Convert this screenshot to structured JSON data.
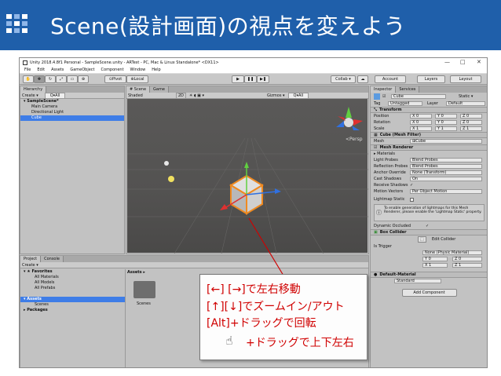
{
  "slide": {
    "title": "Scene(設計画面)の視点を変えよう"
  },
  "window": {
    "title": "Unity 2018.4.8f1 Personal - SampleScene.unity - ARTest - PC, Mac & Linux Standalone* <DX11>",
    "controls": [
      "—",
      "□",
      "✕"
    ]
  },
  "menu": [
    "File",
    "Edit",
    "Assets",
    "GameObject",
    "Component",
    "Window",
    "Help"
  ],
  "toolbar": {
    "pivot": "Pivot",
    "local": "Local",
    "collab": "Collab ▾",
    "account": "Account",
    "layers": "Layers",
    "layout": "Layout"
  },
  "hierarchy": {
    "tab": "Hierarchy",
    "create": "Create ▾",
    "search": "Q▾All",
    "items": [
      {
        "label": "▾ SampleScene*",
        "selected": false
      },
      {
        "label": "Main Camera",
        "selected": false
      },
      {
        "label": "Directional Light",
        "selected": false
      },
      {
        "label": "Cube",
        "selected": true
      }
    ]
  },
  "scene": {
    "tab_scene": "# Scene",
    "tab_game": "Game",
    "shaded": "Shaded",
    "mode2d": "2D",
    "gizmos": "Gizmos ▾",
    "search": "Q▾All",
    "persp": "<Persp"
  },
  "inspector": {
    "tab_inspector": "Inspector",
    "tab_services": "Services",
    "object_name": "Cube",
    "static": "Static ▾",
    "tag_label": "Tag",
    "tag_value": "Untagged",
    "layer_label": "Layer",
    "layer_value": "Default",
    "transform": {
      "title": "Transform",
      "rows": [
        {
          "label": "Position",
          "x": "0",
          "y": "0",
          "z": "0"
        },
        {
          "label": "Rotation",
          "x": "0",
          "y": "0",
          "z": "0"
        },
        {
          "label": "Scale",
          "x": "1",
          "y": "1",
          "z": "1"
        }
      ]
    },
    "mesh_filter": {
      "title": "Cube (Mesh Filter)",
      "mesh_label": "Mesh",
      "mesh_value": "⊞Cube"
    },
    "mesh_renderer": {
      "title": "Mesh Renderer",
      "materials": "▸ Materials",
      "rows": [
        {
          "label": "Light Probes",
          "value": "Blend Probes"
        },
        {
          "label": "Reflection Probes",
          "value": "Blend Probes"
        },
        {
          "label": "Anchor Override",
          "value": "None (Transform)"
        },
        {
          "label": "Cast Shadows",
          "value": "On"
        },
        {
          "label": "Receive Shadows",
          "value": "✓"
        },
        {
          "label": "Motion Vectors",
          "value": "Per Object Motion"
        },
        {
          "label": "Lightmap Static",
          "value": ""
        }
      ],
      "info": "To enable generation of lightmaps for this Mesh Renderer, please enable the 'Lightmap Static' property.",
      "dynamic_occluded": "Dynamic Occluded"
    },
    "box_collider": {
      "title": "Box Collider",
      "edit_collider": "Edit Collider",
      "is_trigger": "Is Trigger",
      "material_value": "None (Physic Material)",
      "center": {
        "x": "0",
        "y": "0",
        "z": "0"
      },
      "size": {
        "x": "1",
        "y": "1",
        "z": "1"
      }
    },
    "default_material": "Default-Material",
    "shader_value": "Standard",
    "add_component": "Add Component"
  },
  "project": {
    "tab_project": "Project",
    "tab_console": "Console",
    "create": "Create ▾",
    "tree": [
      {
        "label": "▾ ★ Favorites",
        "bold": true
      },
      {
        "label": "All Materials",
        "bold": false
      },
      {
        "label": "All Models",
        "bold": false
      },
      {
        "label": "All Prefabs",
        "bold": false
      },
      {
        "label": "",
        "bold": false
      },
      {
        "label": "▾ Assets",
        "bold": true
      },
      {
        "label": "Scenes",
        "bold": false
      },
      {
        "label": "▸ Packages",
        "bold": true
      }
    ],
    "breadcrumb": "Assets ▸",
    "folder": "Scenes"
  },
  "callout": {
    "line1": "[←] [→]で左右移動",
    "line2": "[↑][↓]でズームイン/アウト",
    "line3": "[Alt]+ドラッグで回転",
    "line4": "+ドラッグで上下左右"
  },
  "colors": {
    "header_bg": "#1f5faa",
    "callout_text": "#d00000",
    "selection": "#3e7de7",
    "cube": "#f0a040"
  }
}
